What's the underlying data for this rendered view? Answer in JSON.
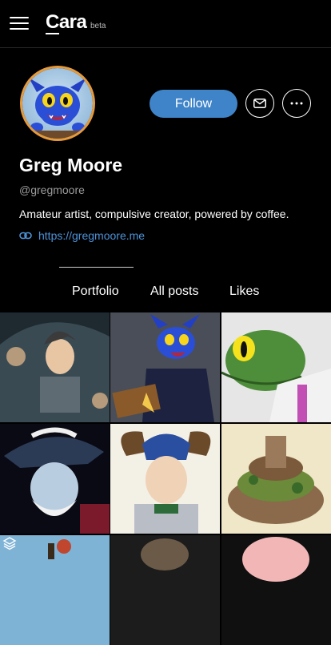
{
  "app": {
    "logo": "Cara",
    "badge": "beta"
  },
  "profile": {
    "follow_label": "Follow",
    "name": "Greg Moore",
    "handle": "@gregmoore",
    "bio": "Amateur artist, compulsive creator, powered by coffee.",
    "link": "https://gregmoore.me"
  },
  "tabs": [
    {
      "label": "Portfolio"
    },
    {
      "label": "All posts"
    },
    {
      "label": "Likes"
    }
  ],
  "icons": {
    "menu": "hamburger-menu-icon",
    "message": "envelope-icon",
    "more": "more-dots-icon",
    "link": "link-icon",
    "stack": "stack-icon"
  },
  "colors": {
    "background": "#000000",
    "accent": "#3f84c9",
    "link": "#4d93d9",
    "muted": "#9a9a9a",
    "avatar_ring": "#e69a3a"
  }
}
